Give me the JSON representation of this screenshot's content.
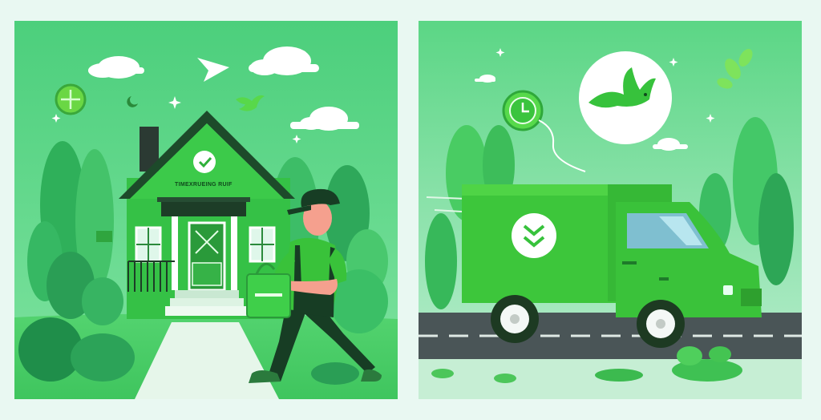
{
  "scene": {
    "left_panel": {
      "house_sign_text": "TIMEXRUEING RUIF"
    },
    "right_panel": {}
  },
  "colors": {
    "background": "#e9f8f2",
    "sky_left": "#4ccf7c",
    "sky_right": "#5bd685",
    "house_green": "#35c146",
    "truck_green": "#3dc63b",
    "roof_dark": "#1d4a2a",
    "road": "#4a5557",
    "shirt": "#39c23a",
    "skin": "#f5a08e",
    "overalls": "#173d24"
  },
  "icons": [
    "check-circle-icon",
    "arrow-badge-icon",
    "double-chevron-down-icon",
    "clock-icon",
    "bird-icon",
    "paper-plane-icon",
    "leaf-icon",
    "sparkle-icon",
    "cloud-icon"
  ]
}
